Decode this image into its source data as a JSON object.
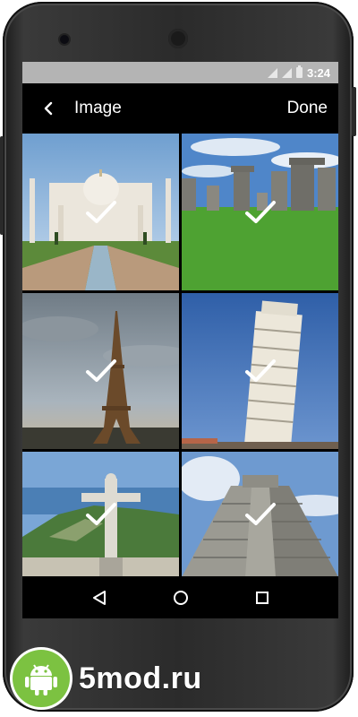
{
  "status_bar": {
    "time": "3:24"
  },
  "toolbar": {
    "back_icon": "chevron-left-icon",
    "title": "Image",
    "done_label": "Done"
  },
  "gallery": {
    "items": [
      {
        "subject": "taj-mahal",
        "selected": true
      },
      {
        "subject": "stonehenge",
        "selected": true
      },
      {
        "subject": "eiffel-tower",
        "selected": true
      },
      {
        "subject": "leaning-tower-of-pisa",
        "selected": true
      },
      {
        "subject": "christ-the-redeemer",
        "selected": true
      },
      {
        "subject": "chichen-itza-pyramid",
        "selected": true
      }
    ]
  },
  "nav_bar": {
    "back_icon": "triangle-back-icon",
    "home_icon": "circle-home-icon",
    "recents_icon": "square-recents-icon"
  },
  "watermark": {
    "text": "5mod.ru",
    "logo_icon": "android-robot-icon",
    "logo_color": "#7cc241"
  }
}
